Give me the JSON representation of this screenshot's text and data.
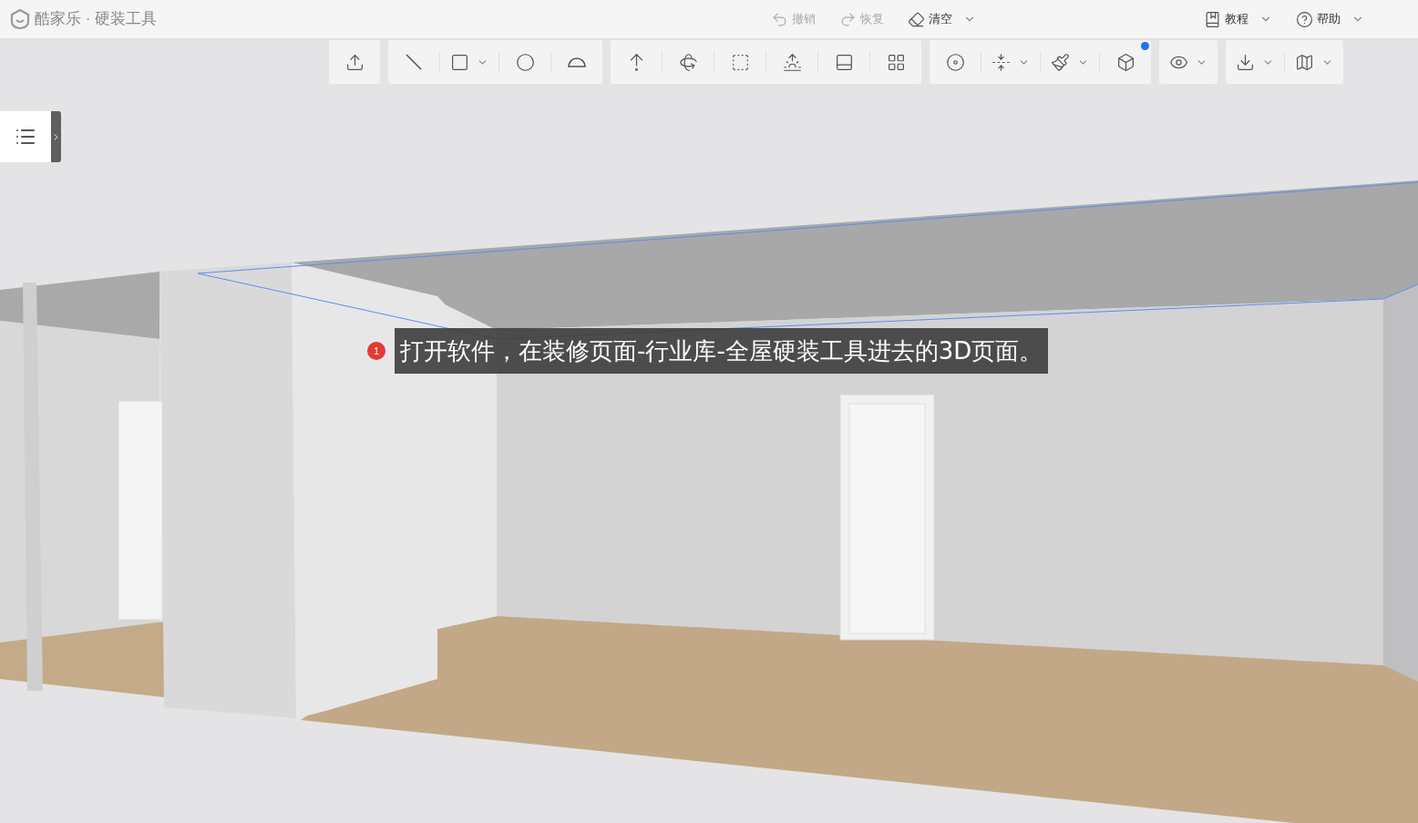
{
  "app": {
    "title": "酷家乐 · 硬装工具"
  },
  "top_actions": [
    {
      "label": "撤销",
      "disabled": true,
      "dropdown": false
    },
    {
      "label": "恢复",
      "disabled": true,
      "dropdown": false
    },
    {
      "label": "清空",
      "disabled": false,
      "dropdown": true
    },
    {
      "label": "教程",
      "disabled": false,
      "dropdown": true
    },
    {
      "label": "帮助",
      "disabled": false,
      "dropdown": true
    }
  ],
  "toolbar": {
    "groups": [
      {
        "tools": [
          {
            "dropdown": false,
            "badge": false
          }
        ]
      },
      {
        "tools": [
          {
            "dropdown": false,
            "badge": false
          },
          {
            "dropdown": true,
            "badge": false
          },
          {
            "dropdown": false,
            "badge": false
          },
          {
            "dropdown": false,
            "badge": false
          }
        ]
      },
      {
        "tools": [
          {
            "dropdown": false,
            "badge": false
          },
          {
            "dropdown": false,
            "badge": false
          },
          {
            "dropdown": false,
            "badge": false
          },
          {
            "dropdown": false,
            "badge": false
          },
          {
            "dropdown": false,
            "badge": false
          },
          {
            "dropdown": false,
            "badge": false
          }
        ]
      },
      {
        "tools": [
          {
            "dropdown": false,
            "badge": false
          },
          {
            "dropdown": true,
            "badge": false
          },
          {
            "dropdown": true,
            "badge": false
          },
          {
            "dropdown": false,
            "badge": true
          }
        ]
      },
      {
        "tools": [
          {
            "dropdown": true,
            "badge": false
          }
        ]
      },
      {
        "tools": [
          {
            "dropdown": true,
            "badge": false
          },
          {
            "dropdown": true,
            "badge": false
          }
        ]
      }
    ]
  },
  "side_panel": {
    "expanded": false
  },
  "caption": {
    "step": "1",
    "text": "打开软件，在装修页面-行业库-全屋硬装工具进去的3D页面。"
  }
}
